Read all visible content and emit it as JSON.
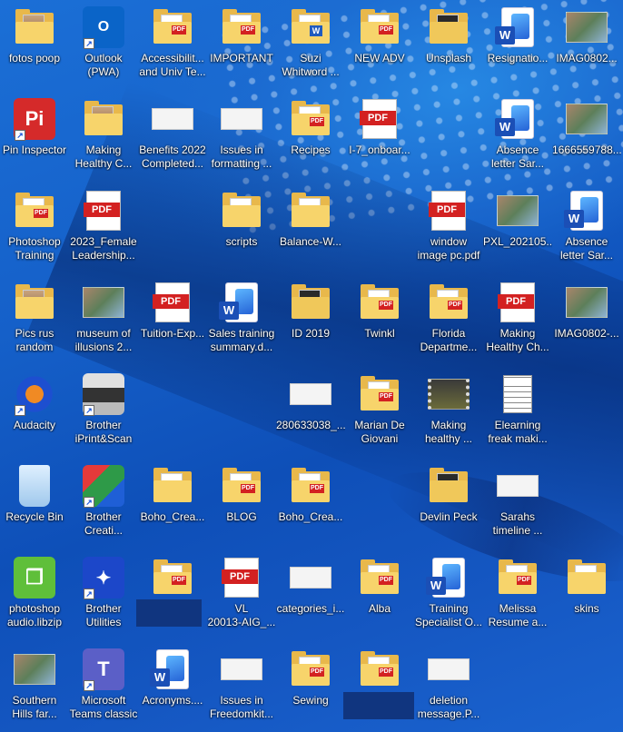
{
  "desktop": {
    "icons": [
      {
        "label": "fotos poop",
        "type": "folder-photo"
      },
      {
        "label": "Outlook (PWA)",
        "type": "outlook"
      },
      {
        "label": "Accessibilit...\nand Univ Te...",
        "type": "folder-pdf"
      },
      {
        "label": "IMPORTANT",
        "type": "folder-pdf"
      },
      {
        "label": "Suzi\nWhitword ...",
        "type": "folder-word"
      },
      {
        "label": "NEW ADV",
        "type": "folder-pdf"
      },
      {
        "label": "Unsplash",
        "type": "folder-dark"
      },
      {
        "label": "Resignatio...",
        "type": "word"
      },
      {
        "label": "IMAG0802...",
        "type": "photo"
      },
      {
        "label": "Pin Inspector",
        "type": "pin"
      },
      {
        "label": "Making\nHealthy C...",
        "type": "folder-photo"
      },
      {
        "label": "Benefits 2022\nCompleted...",
        "type": "screenshot"
      },
      {
        "label": "Issues in\nformatting ...",
        "type": "screenshot"
      },
      {
        "label": "Recipes",
        "type": "folder-pdf"
      },
      {
        "label": "I-7_onboar...",
        "type": "pdf"
      },
      {
        "label": "Absence\nletter Sar...",
        "type": "word"
      },
      {
        "label": "1666559788...",
        "type": "photo"
      },
      {
        "label": "Photoshop\nTraining",
        "type": "folder-pdf"
      },
      {
        "label": "2023_Female\nLeadership...",
        "type": "pdf"
      },
      {
        "label": "scripts",
        "type": "folder"
      },
      {
        "label": "Balance-W...",
        "type": "folder"
      },
      {
        "label": "window\nimage pc.pdf",
        "type": "pdf"
      },
      {
        "label": "PXL_202105...",
        "type": "photo"
      },
      {
        "label": "Absence\nletter Sar...",
        "type": "word"
      },
      {
        "label": "Pics rus\nrandom",
        "type": "folder-photo"
      },
      {
        "label": "museum of\nillusions 2...",
        "type": "photo"
      },
      {
        "label": "Tuition-Exp...",
        "type": "pdf"
      },
      {
        "label": "Sales training\nsummary.d...",
        "type": "word"
      },
      {
        "label": "ID 2019",
        "type": "folder-dark"
      },
      {
        "label": "Twinkl",
        "type": "folder-pdf"
      },
      {
        "label": "Florida\nDepartme...",
        "type": "folder-pdf"
      },
      {
        "label": "Making\nHealthy Ch...",
        "type": "pdf"
      },
      {
        "label": "IMAG0802-...",
        "type": "photo"
      },
      {
        "label": "Audacity",
        "type": "audacity"
      },
      {
        "label": "Brother\niPrint&Scan",
        "type": "printer"
      },
      {
        "label": "280633038_...",
        "type": "screenshot"
      },
      {
        "label": "Marian De\nGiovani",
        "type": "folder-pdf"
      },
      {
        "label": "Making\nhealthy ...",
        "type": "video"
      },
      {
        "label": "Elearning\nfreak maki...",
        "type": "text"
      },
      {
        "label": "Recycle Bin",
        "type": "bin"
      },
      {
        "label": "Brother\nCreati...",
        "type": "brother-creative"
      },
      {
        "label": "Boho_Crea...",
        "type": "folder"
      },
      {
        "label": "BLOG",
        "type": "folder-pdf"
      },
      {
        "label": "Boho_Crea...",
        "type": "folder-pdf"
      },
      {
        "label": "Devlin Peck",
        "type": "folder-dark"
      },
      {
        "label": "Sarahs\ntimeline ...",
        "type": "screenshot"
      },
      {
        "label": "photoshop\naudio.libzip",
        "type": "zip"
      },
      {
        "label": "Brother\nUtilities",
        "type": "brother-util"
      },
      {
        "label": "",
        "type": "folder-pdf"
      },
      {
        "label": "VL\n20013-AIG_...",
        "type": "pdf"
      },
      {
        "label": "categories_i...",
        "type": "screenshot"
      },
      {
        "label": "Alba",
        "type": "folder-pdf"
      },
      {
        "label": "Training\nSpecialist O...",
        "type": "word"
      },
      {
        "label": "Melissa\nResume a...",
        "type": "folder-pdf"
      },
      {
        "label": "skins",
        "type": "folder"
      },
      {
        "label": "Southern\nHills far...",
        "type": "photo"
      },
      {
        "label": "Microsoft\nTeams classic",
        "type": "teams"
      },
      {
        "label": "Acronyms....",
        "type": "word"
      },
      {
        "label": "Issues in\nFreedomkit...",
        "type": "screenshot"
      },
      {
        "label": "Sewing",
        "type": "folder-pdf"
      },
      {
        "label": "",
        "type": "folder-pdf"
      },
      {
        "label": "deletion\nmessage.P...",
        "type": "screenshot"
      }
    ]
  },
  "glyphs": {
    "pdf": "PDF",
    "word": "W",
    "pin": "Pi",
    "teams": "T",
    "shortcut": "↗"
  },
  "colors": {
    "folder": "#e8b84b",
    "pdf_red": "#d32121",
    "word_blue": "#1b4fb6",
    "desktop_blue": "#1560c9"
  }
}
